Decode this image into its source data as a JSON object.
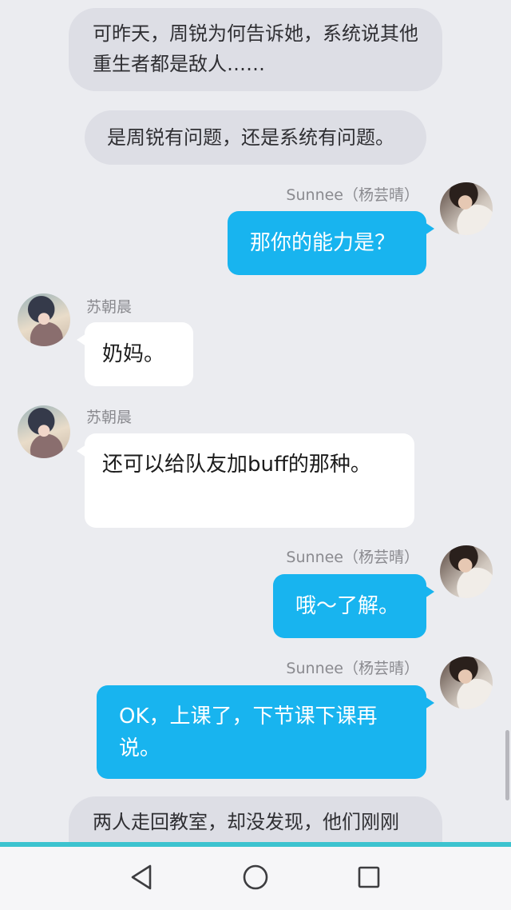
{
  "messages": {
    "narration1": "可昨天，周锐为何告诉她，系统说其他重生者都是敌人……",
    "narration2": "是周锐有问题，还是系统有问题。",
    "sunnee_name": "Sunnee（杨芸晴）",
    "su_name": "苏朝晨",
    "msg1": "那你的能力是？",
    "msg2": "奶妈。",
    "msg3": "还可以给队友加buff的那种。",
    "msg4": "哦～了解。",
    "msg5": "OK，上课了，下节课下课再说。",
    "narration3": "两人走回教室，却没发现，他们刚刚"
  },
  "icons": {
    "back": "back-triangle-icon",
    "home": "home-circle-icon",
    "recent": "recent-square-icon"
  },
  "colors": {
    "background": "#ebecf0",
    "self_bubble": "#18b4ef",
    "other_bubble": "#ffffff",
    "narration_bubble": "#dddee5",
    "accent_line": "#3cc3cf"
  }
}
